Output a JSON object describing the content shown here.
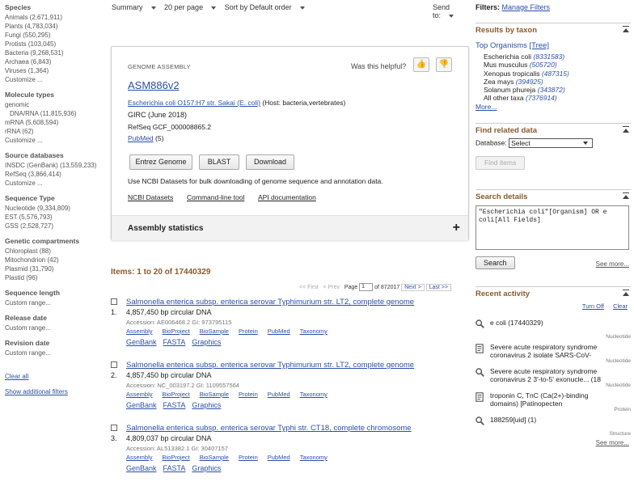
{
  "topbar": {
    "summary": "Summary",
    "per_page": "20 per page",
    "sort": "Sort by Default order",
    "send_to": "Send to:"
  },
  "sidebar": {
    "groups": [
      {
        "title": "Species",
        "items": [
          "Animals (2,671,911)",
          "Plants (4,783,034)",
          "Fungi (550,295)",
          "Protists (103,045)",
          "Bacteria (9,268,531)",
          "Archaea (6,843)",
          "Viruses (1,364)",
          "Customize ..."
        ]
      },
      {
        "title": "Molecule types",
        "items": [
          "genomic",
          "DNA/RNA (11,815,936)",
          "mRNA (5,608,594)",
          "rRNA (62)",
          "Customize ..."
        ]
      },
      {
        "title": "Source databases",
        "items": [
          "INSDC (GenBank) (13,559,233)",
          "RefSeq (3,866,414)",
          "Customize ..."
        ]
      },
      {
        "title": "Sequence Type",
        "items": [
          "Nucleotide (9,334,809)",
          "EST (5,576,793)",
          "GSS (2,528,727)"
        ]
      },
      {
        "title": "Genetic compartments",
        "items": [
          "Chloroplast (88)",
          "Mitochondrion (42)",
          "Plasmid (31,790)",
          "Plastid (96)"
        ]
      },
      {
        "title": "Sequence length",
        "items": [
          "Custom range..."
        ]
      },
      {
        "title": "Release date",
        "items": [
          "Custom range..."
        ]
      },
      {
        "title": "Revision date",
        "items": [
          "Custom range..."
        ]
      }
    ],
    "clear_all": "Clear all",
    "show_additional": "Show additional filters"
  },
  "genome": {
    "label": "GENOME ASSEMBLY",
    "helpful": "Was this helpful?",
    "title": "ASM886v2",
    "organism_link": "Escherichia coli O157:H7 str. Sakai (E. coli)",
    "host": "(Host: bacteria,vertebrates)",
    "girc": "GIRC (June 2018)",
    "refseq": "RefSeq GCF_000008865.2",
    "pubmed": "PubMed",
    "pubmed_count": "(5)",
    "buttons": [
      "Entrez Genome",
      "BLAST",
      "Download"
    ],
    "datasets_note": "Use NCBI Datasets for bulk downloading of genome sequence and annotation data.",
    "links": [
      "NCBI Datasets",
      "Command-line tool",
      "API documentation"
    ],
    "stats_title": "Assembly statistics"
  },
  "results": {
    "title": "Items: 1 to 20 of 17440329",
    "pager": {
      "first": "<< First",
      "prev": "< Prev",
      "page_label": "Page",
      "page": "1",
      "of": "of 872017",
      "next": "Next >",
      "last": "Last >>"
    },
    "items": [
      {
        "num": "1.",
        "title": "Salmonella enterica subsp. enterica serovar Typhimurium str. LT2, complete genome",
        "desc": "4,857,450 bp circular DNA",
        "acc": "Accession: AE006468.2    GI: 973795115"
      },
      {
        "num": "2.",
        "title": "Salmonella enterica subsp. enterica serovar Typhimurium str. LT2, complete genome",
        "desc": "4,857,450 bp circular DNA",
        "acc": "Accession: NC_003197.2    GI: 1109557564"
      },
      {
        "num": "3.",
        "title": "Salmonella enterica subsp. enterica serovar Typhi str. CT18, complete chromosome",
        "desc": "4,809,037 bp circular DNA",
        "acc": "Accession: AL513382.1    GI: 30407157"
      }
    ],
    "links1": [
      "Assembly",
      "BioProject",
      "BioSample",
      "Protein",
      "PubMed",
      "Taxonomy"
    ],
    "links2": [
      "GenBank",
      "FASTA",
      "Graphics"
    ]
  },
  "right": {
    "filters_label": "Filters:",
    "manage_filters": "Manage Filters",
    "taxon": {
      "title": "Results by taxon",
      "top_organisms": "Top Organisms",
      "tree": "[Tree]",
      "rows": [
        {
          "name": "Escherichia coli",
          "count": "(8331583)"
        },
        {
          "name": "Mus musculus",
          "count": "(505720)"
        },
        {
          "name": "Xenopus tropicalis",
          "count": "(487315)"
        },
        {
          "name": "Zea mays",
          "count": "(394925)"
        },
        {
          "name": "Solanum phureja",
          "count": "(343872)"
        },
        {
          "name": "All other taxa",
          "count": "(7376914)"
        }
      ],
      "more": "More..."
    },
    "related": {
      "title": "Find related data",
      "db_label": "Database:",
      "db_value": "Select",
      "find_btn": "Find items"
    },
    "search": {
      "title": "Search details",
      "query": "\"Escherichia coli\"[Organism] OR e\ncoli[All Fields]",
      "search_btn": "Search",
      "see_more": "See more..."
    },
    "activity": {
      "title": "Recent activity",
      "turn_off": "Turn Off",
      "clear": "Clear",
      "items": [
        {
          "icon": "search-icon",
          "text": "e coli (17440329)",
          "cat": "Nucleotide"
        },
        {
          "icon": "document-icon",
          "text": "Severe acute respiratory syndrome coronavirus 2 isolate SARS-CoV-",
          "cat": "Nucleotide"
        },
        {
          "icon": "search-icon",
          "text": "Severe acute respiratory syndrome coronavirus 2 3'-to-5' exonucle... (18",
          "cat": "Nucleotide"
        },
        {
          "icon": "document-icon",
          "text": "troponin C, TnC (Ca(2+)-binding domains) [Patinopecten yessoensis=Ezo-giant sc",
          "cat": "Protein"
        },
        {
          "icon": "search-icon",
          "text": "188259[uid] (1)",
          "cat": "Structure"
        }
      ],
      "see_more": "See more..."
    }
  }
}
